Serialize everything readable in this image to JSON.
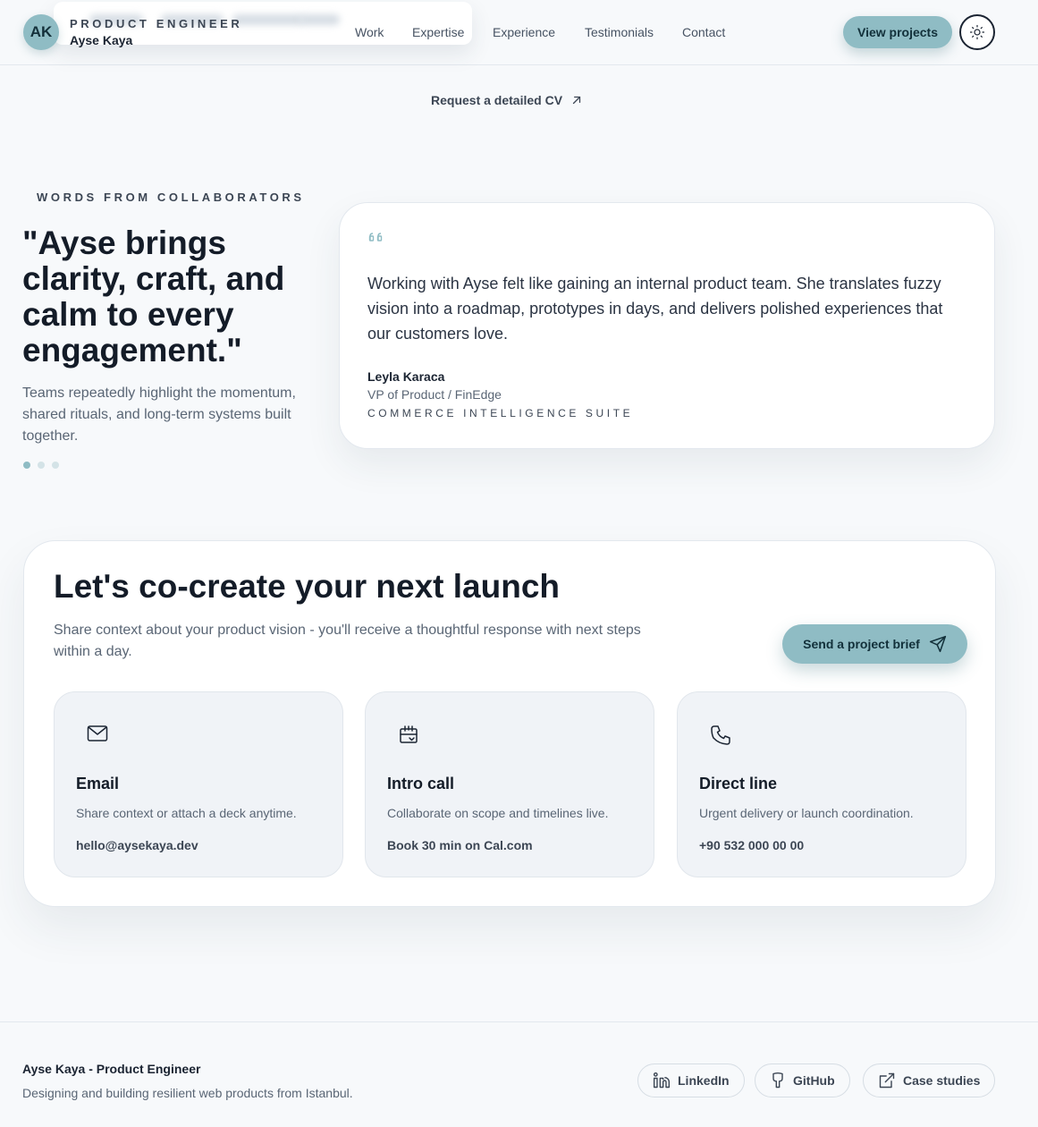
{
  "header": {
    "avatar_initials": "AK",
    "role": "PRODUCT ENGINEER",
    "name": "Ayse Kaya",
    "nav": [
      {
        "label": "Work"
      },
      {
        "label": "Expertise"
      },
      {
        "label": "Experience"
      },
      {
        "label": "Testimonials"
      },
      {
        "label": "Contact"
      }
    ],
    "cta_label": "View projects",
    "theme_toggle_icon": "sun-icon"
  },
  "cv_link": {
    "label": "Request a detailed CV",
    "icon": "arrow-up-right-icon"
  },
  "testimonials": {
    "eyebrow": "WORDS FROM COLLABORATORS",
    "headline": "\"Ayse brings clarity, craft, and calm to every engagement.\"",
    "subtext": "Teams repeatedly highlight the momentum, shared rituals, and long-term systems built together.",
    "active_index": 0,
    "total": 3,
    "card": {
      "quote": "Working with Ayse felt like gaining an internal product team. She translates fuzzy vision into a roadmap, prototypes in days, and delivers polished experiences that our customers love.",
      "author": "Leyla Karaca",
      "role": "VP of Product / FinEdge",
      "project": "COMMERCE INTELLIGENCE SUITE"
    }
  },
  "contact": {
    "title": "Let's co-create your next launch",
    "description": "Share context about your product vision - you'll receive a thoughtful response with next steps within a day.",
    "cta_label": "Send a project brief",
    "cards": [
      {
        "icon": "mail-icon",
        "title": "Email",
        "desc": "Share context or attach a deck anytime.",
        "value": "hello@aysekaya.dev"
      },
      {
        "icon": "calendar-icon",
        "title": "Intro call",
        "desc": "Collaborate on scope and timelines live.",
        "value": "Book 30 min on Cal.com"
      },
      {
        "icon": "phone-icon",
        "title": "Direct line",
        "desc": "Urgent delivery or launch coordination.",
        "value": "+90 532 000 00 00"
      }
    ]
  },
  "footer": {
    "name": "Ayse Kaya - Product Engineer",
    "tagline": "Designing and building resilient web products from Istanbul.",
    "links": [
      {
        "icon": "linkedin-icon",
        "label": "LinkedIn"
      },
      {
        "icon": "github-icon",
        "label": "GitHub"
      },
      {
        "icon": "external-link-icon",
        "label": "Case studies"
      }
    ]
  },
  "colors": {
    "accent": "#8fbcc4",
    "background": "#f7f9fb",
    "heading": "#141c28",
    "muted": "#5a6675"
  }
}
